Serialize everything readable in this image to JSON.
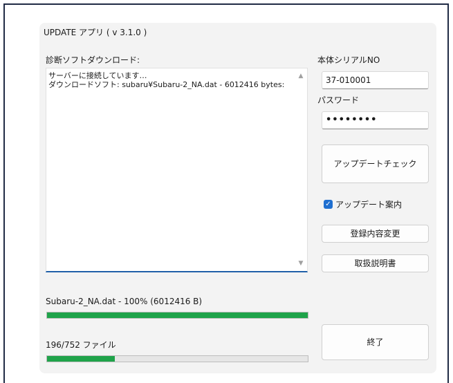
{
  "window": {
    "title": "UPDATE アプリ ( v 3.1.0 )"
  },
  "download_section": {
    "label": "診断ソフトダウンロード:",
    "log_text": "サーバーに接続しています…\nダウンロードソフト: subaru¥Subaru-2_NA.dat - 6012416 bytes:"
  },
  "serial": {
    "label": "本体シリアルNO",
    "value": "37-010001"
  },
  "password": {
    "label": "パスワード",
    "value": "••••••••"
  },
  "buttons": {
    "update_check": "アップデートチェック",
    "registration_change": "登録内容変更",
    "manual": "取扱説明書",
    "exit": "終了"
  },
  "update_notice": {
    "label": "アップデート案内",
    "checked": true
  },
  "file_progress": {
    "label": "Subaru-2_NA.dat - 100% (6012416 B)",
    "percent": 100
  },
  "overall_progress": {
    "label": "196/752 ファイル",
    "current": 196,
    "total": 752
  },
  "colors": {
    "progress": "#1fa34a",
    "accent": "#1f6fd0",
    "frame": "#1f2a44"
  }
}
